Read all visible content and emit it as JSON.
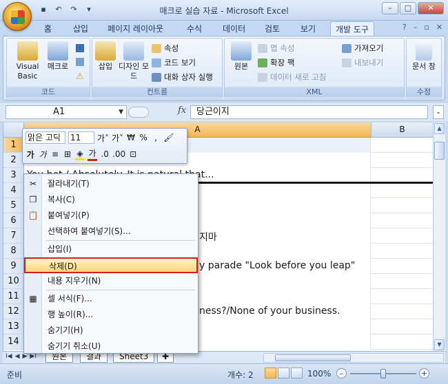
{
  "window": {
    "title": "매크로 실습 자료 - Microsoft Excel"
  },
  "quick_access": {
    "save_icon": "save-icon",
    "undo_icon": "undo-icon",
    "redo_icon": "redo-icon"
  },
  "tabs": [
    {
      "label": "홈"
    },
    {
      "label": "삽입"
    },
    {
      "label": "페이지 레이아웃"
    },
    {
      "label": "수식"
    },
    {
      "label": "데이터"
    },
    {
      "label": "검토"
    },
    {
      "label": "보기"
    },
    {
      "label": "개발 도구"
    }
  ],
  "ribbon": {
    "code": {
      "label": "코드",
      "visual_basic": "Visual Basic",
      "macro": "매크로"
    },
    "controls": {
      "label": "컨트롤",
      "insert": "삽입",
      "design_mode": "디자인 모드",
      "properties": "속성",
      "view_code": "코드 보기",
      "run_dialog": "대화 상자 실행"
    },
    "xml": {
      "label": "XML",
      "source": "원본",
      "map_properties": "맵 속성",
      "expansion_packs": "확장 팩",
      "refresh_data": "데이터 새로 고침",
      "import": "가져오기",
      "export": "내보내기"
    },
    "modify": {
      "label": "수정",
      "document_panel": "문서 창"
    }
  },
  "formula_bar": {
    "name_box": "A1",
    "fx": "fx",
    "formula": "당근이지"
  },
  "grid": {
    "columns": [
      "A",
      "B"
    ],
    "rows": [
      {
        "num": "1",
        "text": ""
      },
      {
        "num": "2",
        "text": ""
      },
      {
        "num": "3",
        "text": "You bet / Absolutely. It is natural that..."
      },
      {
        "num": "4",
        "text": ""
      },
      {
        "num": "5",
        "text": ""
      },
      {
        "num": "6",
        "text": ""
      },
      {
        "num": "7",
        "text": "지마"
      },
      {
        "num": "8",
        "text": ""
      },
      {
        "num": "9",
        "text": "y parade \"Look before you leap\""
      },
      {
        "num": "10",
        "text": ""
      },
      {
        "num": "11",
        "text": ""
      },
      {
        "num": "12",
        "text": "ness?/None of your business."
      },
      {
        "num": "13",
        "text": ""
      },
      {
        "num": "14",
        "text": ""
      }
    ]
  },
  "mini_toolbar": {
    "font": "맑은 고딕",
    "size": "11",
    "currency": "₩",
    "percent": "%",
    "comma": ","
  },
  "context_menu": {
    "items": [
      {
        "label": "잘라내기(T)",
        "icon": "cut-icon"
      },
      {
        "label": "복사(C)",
        "icon": "copy-icon"
      },
      {
        "label": "붙여넣기(P)",
        "icon": "paste-icon"
      },
      {
        "label": "선택하여 붙여넣기(S)...",
        "icon": ""
      },
      {
        "label": "삽입(I)",
        "icon": ""
      },
      {
        "label": "삭제(D)",
        "icon": ""
      },
      {
        "label": "내용 지우기(N)",
        "icon": ""
      },
      {
        "label": "셀 서식(F)...",
        "icon": "format-cells-icon"
      },
      {
        "label": "행 높이(R)...",
        "icon": ""
      },
      {
        "label": "숨기기(H)",
        "icon": ""
      },
      {
        "label": "숨기기 취소(U)",
        "icon": ""
      }
    ]
  },
  "sheets": [
    {
      "label": "원본"
    },
    {
      "label": "결과"
    },
    {
      "label": "Sheet3"
    }
  ],
  "status": {
    "ready": "준비",
    "count": "개수: 2",
    "zoom": "100%"
  }
}
